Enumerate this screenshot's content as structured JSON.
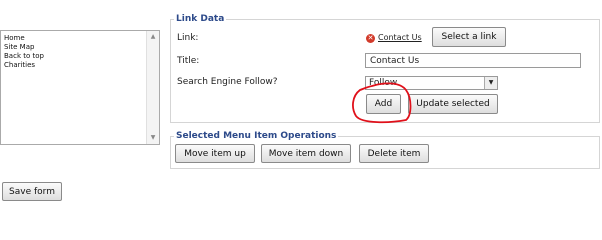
{
  "menu": {
    "items": [
      "Home",
      "Site Map",
      "Back to top",
      "Charities"
    ]
  },
  "link_data": {
    "legend": "Link Data",
    "link_label": "Link:",
    "link_value": "Contact Us",
    "select_link_button": "Select a link",
    "title_label": "Title:",
    "title_value": "Contact Us",
    "follow_label": "Search Engine Follow?",
    "follow_value": "Follow",
    "add_button": "Add",
    "update_button": "Update selected"
  },
  "operations": {
    "legend": "Selected Menu Item Operations",
    "move_up_button": "Move item up",
    "move_down_button": "Move item down",
    "delete_button": "Delete item"
  },
  "save_form_button": "Save form",
  "colors": {
    "legend": "#2d4a8a",
    "annotation": "#e0101a"
  }
}
